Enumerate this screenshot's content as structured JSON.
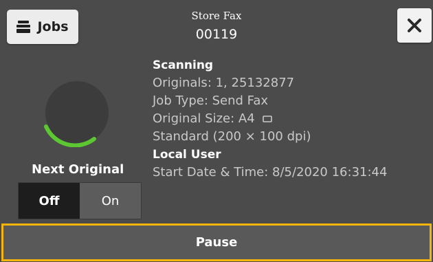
{
  "header": {
    "jobs_label": "Jobs",
    "job_name": "Store Fax",
    "job_number": "00119"
  },
  "status": {
    "state": "Scanning",
    "originals": "Originals: 1, 25132877",
    "job_type": "Job Type: Send Fax",
    "original_size": "Original Size: A4",
    "resolution": "Standard (200 × 100 dpi)",
    "user": "Local User",
    "start": "Start Date & Time: 8/5/2020 16:31:44"
  },
  "next_original": {
    "label": "Next Original",
    "options": [
      "Off",
      "On"
    ],
    "selected": "Off"
  },
  "footer": {
    "pause_label": "Pause"
  },
  "icons": {
    "jobs": "jobs-stack-icon",
    "close": "close-icon",
    "paper": "paper-landscape-icon",
    "progress": "progress-ring-icon"
  },
  "colors": {
    "background": "#4b4b4b",
    "progress": "#5cc733",
    "highlight": "#f5b50d"
  }
}
